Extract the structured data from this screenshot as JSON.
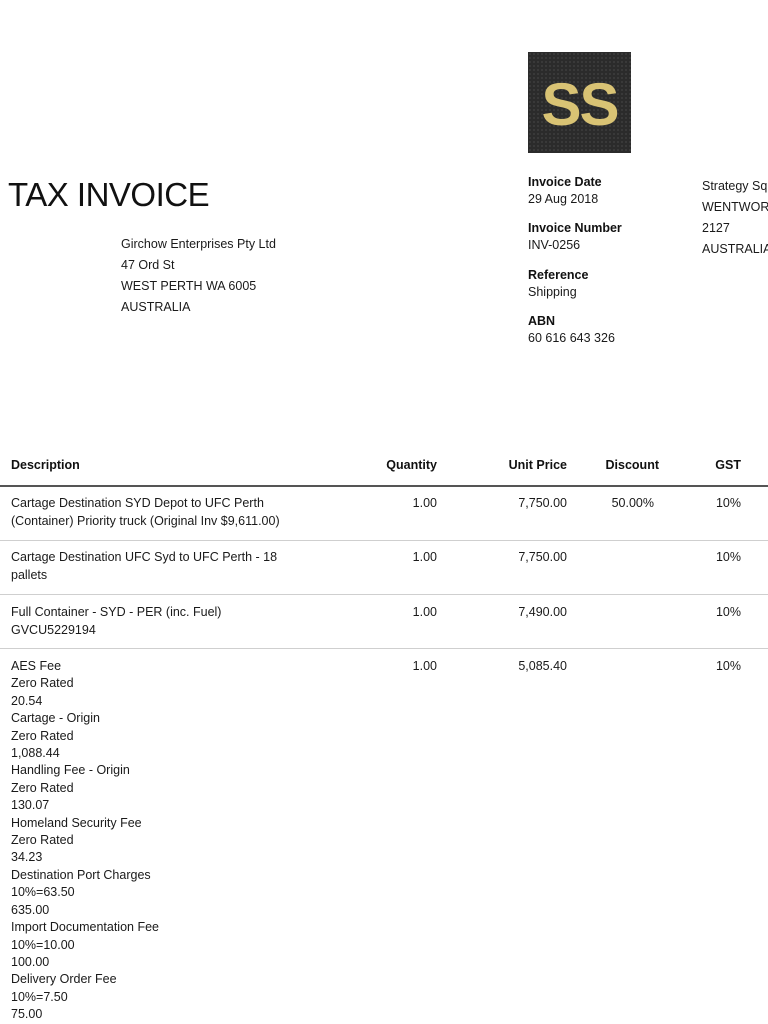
{
  "document": {
    "title": "TAX INVOICE",
    "logo_text": "SS",
    "colors": {
      "logo_bg": "#2b2b2b",
      "logo_gold": "#d9c374",
      "rule": "#9a9a9a"
    }
  },
  "customer": {
    "lines": [
      "Girchow Enterprises Pty Ltd",
      "47 Ord St",
      "WEST PERTH WA 6005",
      "AUSTRALIA"
    ]
  },
  "invoice_meta": [
    {
      "label": "Invoice Date",
      "value": "29 Aug 2018"
    },
    {
      "label": "Invoice Number",
      "value": "INV-0256"
    },
    {
      "label": "Reference",
      "value": "Shipping"
    },
    {
      "label": "ABN",
      "value": "60 616 643 326"
    }
  ],
  "supplier": {
    "lines": [
      "Strategy Sq",
      "WENTWOR",
      "2127",
      "AUSTRALIA"
    ]
  },
  "table": {
    "headers": {
      "description": "Description",
      "quantity": "Quantity",
      "unit_price": "Unit Price",
      "discount": "Discount",
      "gst": "GST"
    },
    "rows": [
      {
        "description": [
          "Cartage Destination SYD Depot to UFC Perth",
          "(Container) Priority truck (Original Inv $9,611.00)"
        ],
        "quantity": "1.00",
        "unit_price": "7,750.00",
        "discount": "50.00%",
        "gst": "10%"
      },
      {
        "description": [
          "Cartage Destination UFC Syd to UFC Perth - 18",
          "pallets"
        ],
        "quantity": "1.00",
        "unit_price": "7,750.00",
        "discount": "",
        "gst": "10%"
      },
      {
        "description": [
          "Full Container - SYD - PER (inc. Fuel)",
          "GVCU5229194"
        ],
        "quantity": "1.00",
        "unit_price": "7,490.00",
        "discount": "",
        "gst": "10%"
      },
      {
        "description": [
          "AES Fee",
          "Zero Rated",
          "20.54",
          "Cartage - Origin",
          "Zero Rated",
          "1,088.44",
          "Handling Fee - Origin",
          "Zero Rated",
          "130.07",
          "Homeland Security Fee",
          "Zero Rated",
          "34.23",
          "Destination Port Charges",
          "10%=63.50",
          "635.00",
          "Import Documentation Fee",
          "10%=10.00",
          "100.00",
          "Delivery Order Fee",
          "10%=7.50",
          "75.00"
        ],
        "quantity": "1.00",
        "unit_price": "5,085.40",
        "discount": "",
        "gst": "10%"
      }
    ]
  }
}
